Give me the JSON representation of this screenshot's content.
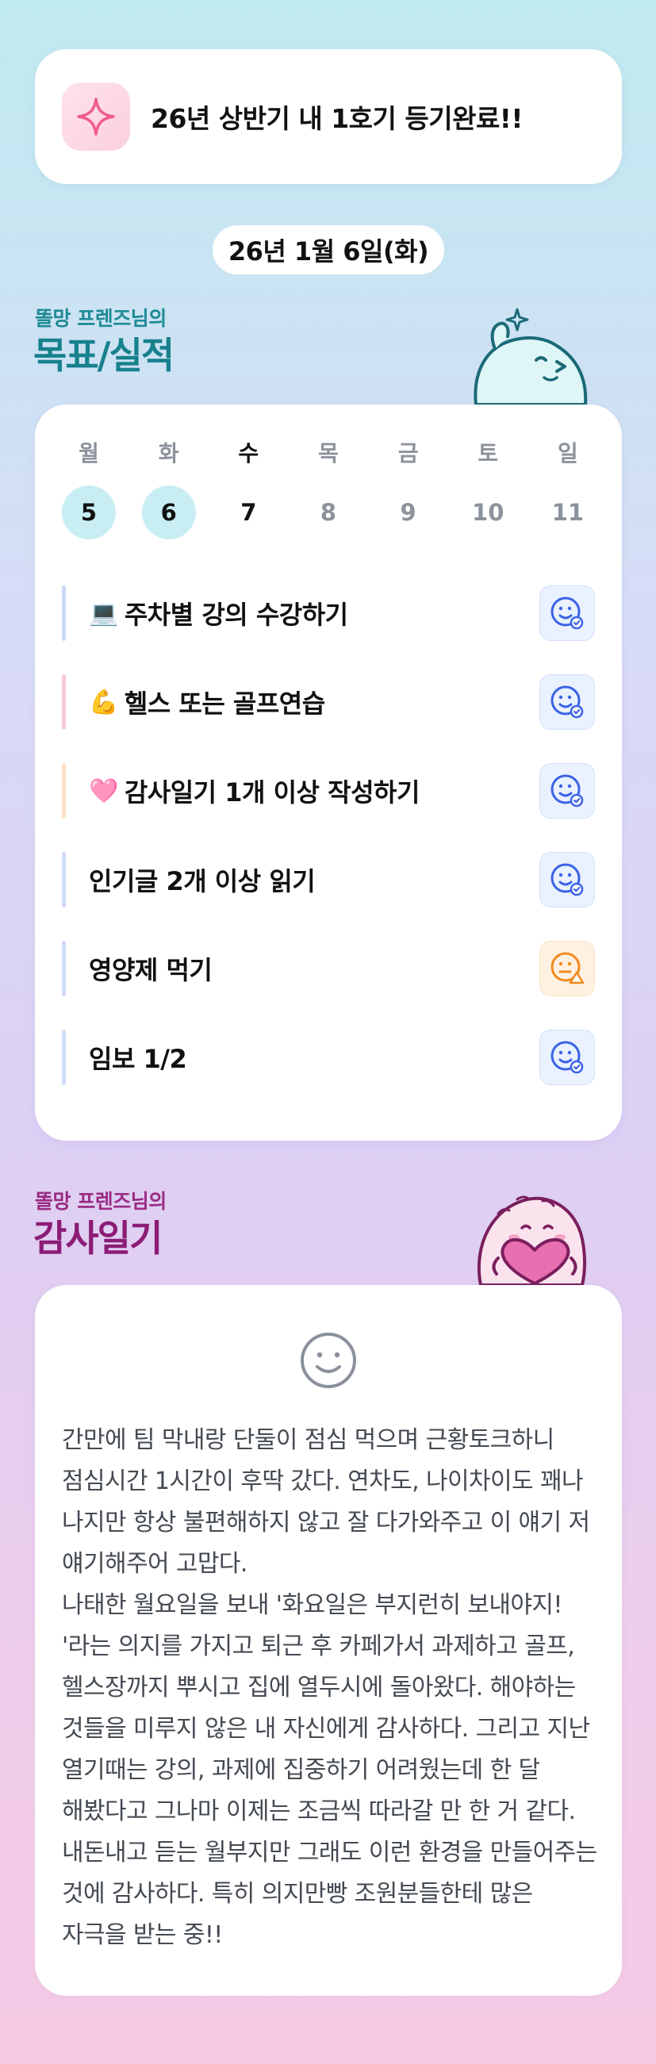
{
  "banner": {
    "text": "26년 상반기 내 1호기 등기완료!!",
    "icon": "sparkle-icon"
  },
  "date": "26년 1월 6일(화)",
  "goals_section": {
    "subtitle": "똘망 프렌즈님의",
    "title": "목표/실적"
  },
  "week": {
    "days": [
      {
        "label": "월",
        "date": "5",
        "state": "done"
      },
      {
        "label": "화",
        "date": "6",
        "state": "done"
      },
      {
        "label": "수",
        "date": "7",
        "state": "today"
      },
      {
        "label": "목",
        "date": "8",
        "state": "future"
      },
      {
        "label": "금",
        "date": "9",
        "state": "future"
      },
      {
        "label": "토",
        "date": "10",
        "state": "future"
      },
      {
        "label": "일",
        "date": "11",
        "state": "future"
      }
    ]
  },
  "goals": [
    {
      "emoji": "💻",
      "text": "주차별 강의 수강하기",
      "bar_color": "#c9d8f5",
      "status": "ok",
      "status_icon": "smile-check-icon"
    },
    {
      "emoji": "💪",
      "text": "헬스 또는 골프연습",
      "bar_color": "#f7c8dc",
      "status": "ok",
      "status_icon": "smile-check-icon"
    },
    {
      "emoji": "🩷",
      "text": "감사일기 1개 이상 작성하기",
      "bar_color": "#fbe1c4",
      "status": "ok",
      "status_icon": "smile-check-icon"
    },
    {
      "emoji": "",
      "text": "인기글 2개 이상 읽기",
      "bar_color": "#cfdcf6",
      "status": "ok",
      "status_icon": "smile-check-icon"
    },
    {
      "emoji": "",
      "text": "영양제 먹기",
      "bar_color": "#cfdcf6",
      "status": "warn",
      "status_icon": "smile-warning-icon"
    },
    {
      "emoji": "",
      "text": "임보 1/2",
      "bar_color": "#cfdcf6",
      "status": "ok",
      "status_icon": "smile-check-icon"
    }
  ],
  "gratitude_section": {
    "subtitle": "똘망 프렌즈님의",
    "title": "감사일기"
  },
  "gratitude": {
    "mood_icon": "smile-face-icon",
    "body": "간만에 팀 막내랑 단둘이 점심 먹으며 근황토크하니 점심시간 1시간이 후딱 갔다. 연차도, 나이차이도 꽤나 나지만 항상 불편해하지 않고 잘 다가와주고 이 얘기 저 얘기해주어 고맙다.\n나태한 월요일을 보내 '화요일은 부지런히 보내야지! '라는 의지를 가지고 퇴근 후 카페가서 과제하고 골프, 헬스장까지 뿌시고 집에 열두시에 돌아왔다. 해야하는 것들을 미루지 않은 내 자신에게 감사하다. 그리고 지난 열기때는 강의, 과제에 집중하기 어려웠는데 한 달 해봤다고 그나마 이제는 조금씩 따라갈 만 한 거 같다. 내돈내고 듣는 월부지만 그래도 이런 환경을 만들어주는 것에 감사하다. 특히 의지만빵 조원분들한테 많은 자극을 받는 중!!"
  },
  "colors": {
    "goal_accent": "#18818e",
    "gratitude_accent": "#8c1c76",
    "check_blue": "#3a63e6",
    "warn_orange": "#f08a1c",
    "done_date_bg": "#c8eef3"
  }
}
